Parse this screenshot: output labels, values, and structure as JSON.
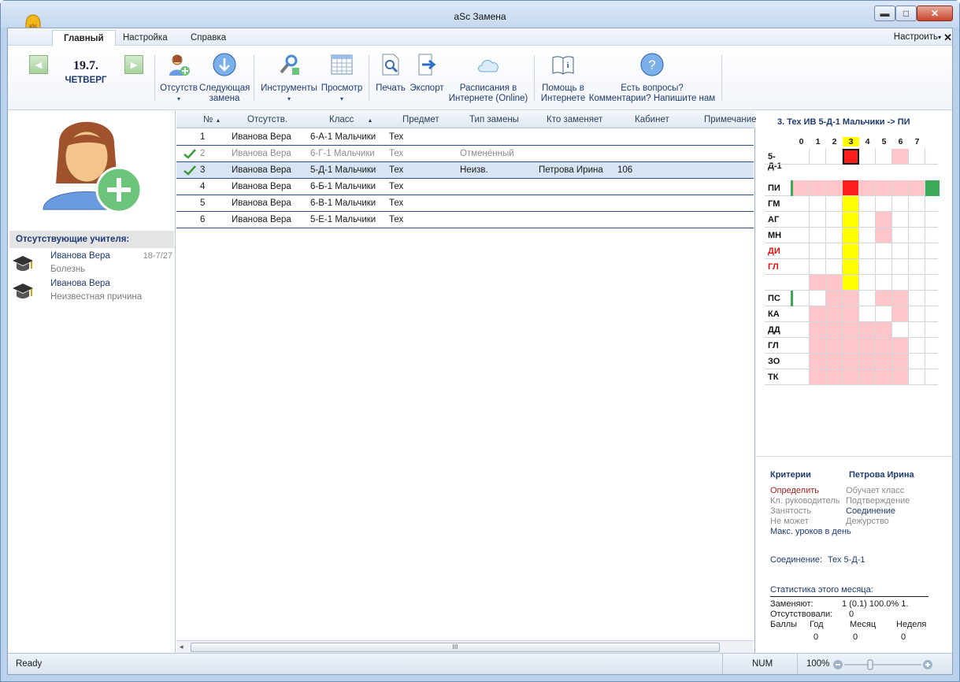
{
  "window": {
    "title": "aSc Замена",
    "app_badge": "aSc"
  },
  "menu": {
    "tabs": [
      {
        "label": "Главный",
        "active": true
      },
      {
        "label": "Настройка"
      },
      {
        "label": "Справка"
      }
    ],
    "right": "Настроить",
    "right_arrow": "▾",
    "close": "✕"
  },
  "ribbon": {
    "date": "19.7.",
    "weekday": "ЧЕТВЕРГ",
    "buttons": [
      {
        "label": "Отсутств",
        "has_arrow": true
      },
      {
        "label": "Следующая",
        "label2": "замена"
      },
      {
        "label": "Инструменты",
        "has_arrow": true
      },
      {
        "label": "Просмотр",
        "has_arrow": true
      },
      {
        "label": "Печать"
      },
      {
        "label": "Экспорт"
      },
      {
        "label": "Расписания в",
        "label2": "Интернете (Online)"
      },
      {
        "label": "Помощь в",
        "label2": "Интернете"
      },
      {
        "label": "Есть вопросы?",
        "label2": "Комментарии? Напишите нам"
      }
    ],
    "dropdown_arrow": "▾"
  },
  "left": {
    "header": "Отсутствующие учителя:",
    "items": [
      {
        "name": "Иванова Вера",
        "reason": "Болезнь",
        "date": "18-7/27"
      },
      {
        "name": "Иванова Вера",
        "reason": "Неизвестная причина",
        "date": ""
      }
    ]
  },
  "grid": {
    "columns": [
      "№",
      "Отсутств.",
      "Класс",
      "Предмет",
      "Тип замены",
      "Кто заменяет",
      "Кабинет",
      "Примечание"
    ],
    "sort_arrow": "▲",
    "rows": [
      {
        "no": "1",
        "absent": "Иванова Вера",
        "class": "6-А-1 Мальчики",
        "subject": "Тех",
        "type": "",
        "who": "",
        "room": "",
        "checked": false,
        "dim": false,
        "selected": false
      },
      {
        "no": "2",
        "absent": "Иванова Вера",
        "class": "6-Г-1 Мальчики",
        "subject": "Тех",
        "type": "Отменённый",
        "who": "",
        "room": "",
        "checked": true,
        "dim": true,
        "selected": false
      },
      {
        "no": "3",
        "absent": "Иванова Вера",
        "class": "5-Д-1 Мальчики",
        "subject": "Тех",
        "type": "Неизв.",
        "who": "Петрова Ирина",
        "room": "106",
        "checked": true,
        "dim": false,
        "selected": true
      },
      {
        "no": "4",
        "absent": "Иванова Вера",
        "class": "6-Б-1 Мальчики",
        "subject": "Тех",
        "type": "",
        "who": "",
        "room": "",
        "checked": false,
        "dim": false,
        "selected": false
      },
      {
        "no": "5",
        "absent": "Иванова Вера",
        "class": "6-В-1 Мальчики",
        "subject": "Тех",
        "type": "",
        "who": "",
        "room": "",
        "checked": false,
        "dim": false,
        "selected": false
      },
      {
        "no": "6",
        "absent": "Иванова Вера",
        "class": "5-Е-1 Мальчики",
        "subject": "Тех",
        "type": "",
        "who": "",
        "room": "",
        "checked": false,
        "dim": false,
        "selected": false
      }
    ],
    "scroll": {
      "left": "◂",
      "thumb": "III"
    }
  },
  "right": {
    "title": "3. Тех ИВ 5-Д-1  Мальчики -> ПИ",
    "periods": [
      "0",
      "1",
      "2",
      "3",
      "4",
      "5",
      "6",
      "7"
    ],
    "highlight_period": 3,
    "class_row": {
      "label": "5-Д-1",
      "cells": [
        "w",
        "w",
        "w",
        "r",
        "w",
        "w",
        "p",
        "w"
      ]
    },
    "teacher_rows": [
      {
        "label": "ПИ",
        "color": "#111",
        "cells": [
          "p",
          "p",
          "p",
          "r",
          "p",
          "p",
          "p",
          "p"
        ],
        "edge": "g"
      },
      {
        "label": "ГМ",
        "color": "#111",
        "cells": [
          "w",
          "w",
          "w",
          "y",
          "w",
          "w",
          "w",
          "w"
        ]
      },
      {
        "label": "АГ",
        "color": "#111",
        "cells": [
          "w",
          "w",
          "w",
          "y",
          "w",
          "p",
          "w",
          "w"
        ]
      },
      {
        "label": "МН",
        "color": "#111",
        "cells": [
          "w",
          "w",
          "w",
          "y",
          "w",
          "p",
          "w",
          "w"
        ]
      },
      {
        "label": "ДИ",
        "color": "#d11",
        "cells": [
          "w",
          "w",
          "w",
          "y",
          "w",
          "w",
          "w",
          "w"
        ]
      },
      {
        "label": "ГЛ",
        "color": "#d11",
        "cells": [
          "w",
          "w",
          "w",
          "y",
          "w",
          "w",
          "w",
          "w"
        ]
      },
      {
        "label": "",
        "color": "#111",
        "cells": [
          "w",
          "p",
          "p",
          "y",
          "w",
          "w",
          "w",
          "w"
        ]
      },
      {
        "label": "ПС",
        "color": "#111",
        "cells": [
          "w",
          "w",
          "p",
          "p",
          "w",
          "p",
          "p",
          "w"
        ],
        "edge": "g"
      },
      {
        "label": "КА",
        "color": "#111",
        "cells": [
          "w",
          "p",
          "p",
          "p",
          "w",
          "w",
          "p",
          "w"
        ]
      },
      {
        "label": "ДД",
        "color": "#111",
        "cells": [
          "w",
          "p",
          "p",
          "p",
          "p",
          "p",
          "w",
          "w"
        ]
      },
      {
        "label": "ГЛ",
        "color": "#111",
        "cells": [
          "w",
          "p",
          "p",
          "p",
          "p",
          "p",
          "p",
          "w"
        ]
      },
      {
        "label": "ЗО",
        "color": "#111",
        "cells": [
          "w",
          "p",
          "p",
          "p",
          "p",
          "p",
          "p",
          "w"
        ]
      },
      {
        "label": "ТК",
        "color": "#111",
        "cells": [
          "w",
          "p",
          "p",
          "p",
          "p",
          "p",
          "p",
          "w"
        ]
      }
    ],
    "criteria": {
      "col1_title": "Критерии",
      "col2_title": "Петрова Ирина",
      "col1": [
        {
          "t": "Определить",
          "c": "#a81d1d"
        },
        {
          "t": "Кл. руководитель",
          "c": "#8a8a8a"
        },
        {
          "t": "Занятость",
          "c": "#8a8a8a"
        },
        {
          "t": "Не может",
          "c": "#8a8a8a"
        },
        {
          "t": "Макс. уроков в день",
          "c": "#1f3a72"
        }
      ],
      "col2": [
        {
          "t": "Обучает класс",
          "c": "#8a8a8a"
        },
        {
          "t": "Подтверждение",
          "c": "#8a8a8a"
        },
        {
          "t": "Соединение",
          "c": "#1f3a72"
        },
        {
          "t": "Дежурство",
          "c": "#8a8a8a"
        }
      ],
      "join_label": "Соединение:",
      "join_value": "Тех  5-Д-1"
    },
    "stats": {
      "title": "Статистика этого месяца:",
      "replace_label": "Заменяют:",
      "replace_value": "1 (0.1)  100.0% 1.",
      "absent_label": "Отсутствовали:",
      "absent_value": "0",
      "cols": [
        "Баллы",
        "Год",
        "Месяц",
        "Неделя"
      ],
      "vals": [
        "0",
        "0",
        "0"
      ]
    }
  },
  "status": {
    "ready": "Ready",
    "num": "NUM",
    "zoom": "100%"
  }
}
